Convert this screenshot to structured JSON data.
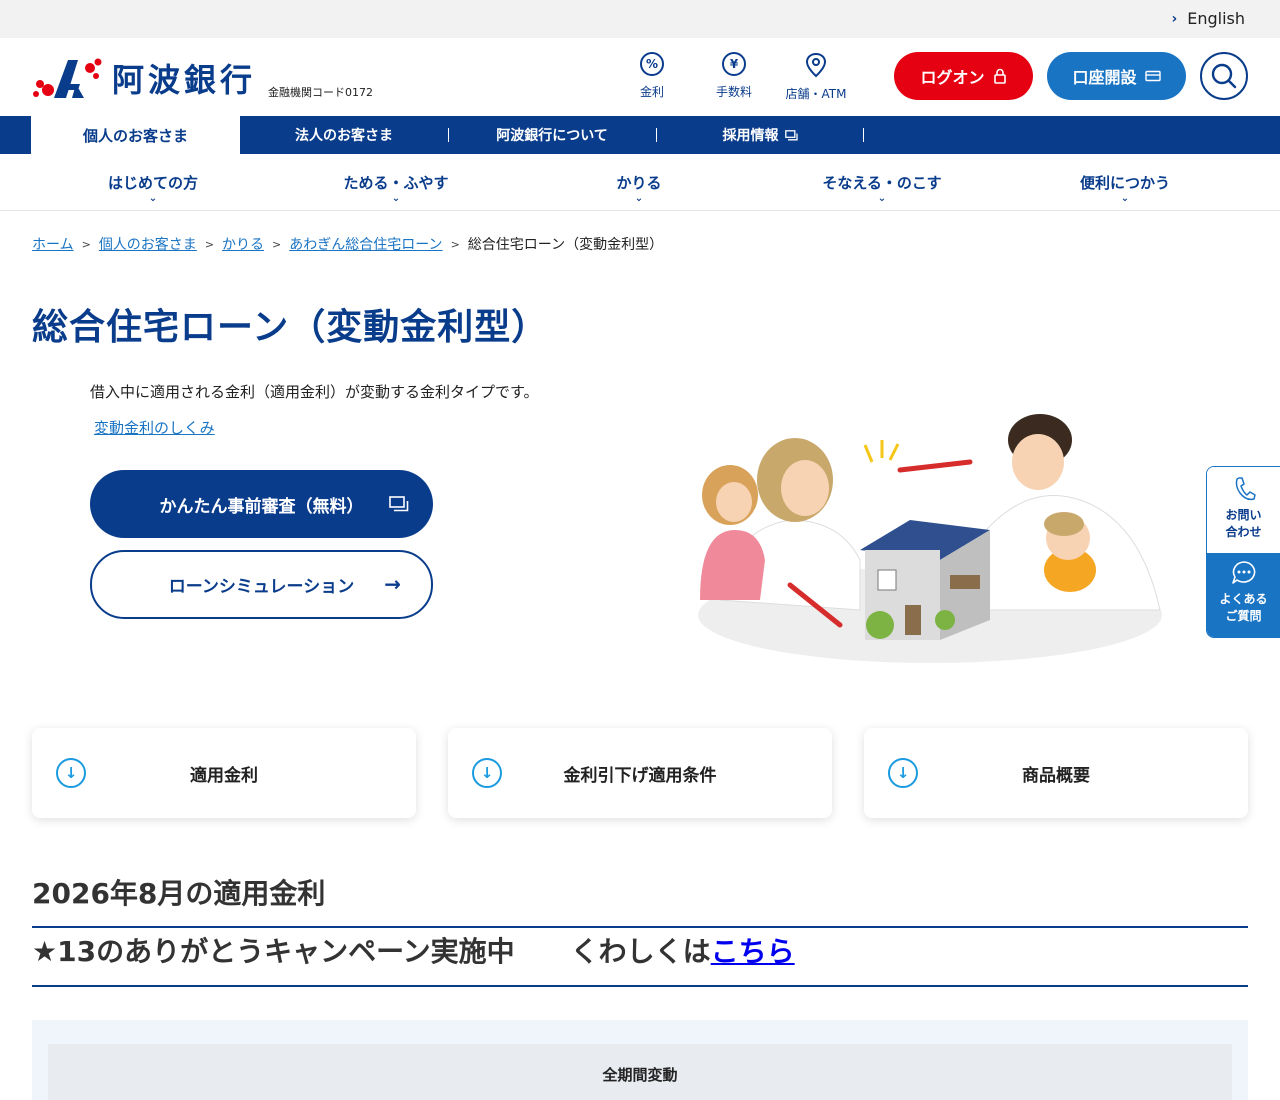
{
  "topbar": {
    "english": "English"
  },
  "header": {
    "bank_name": "阿波銀行",
    "bank_code": "金融機関コード0172",
    "utils": [
      {
        "label": "金利",
        "icon": "percent-icon"
      },
      {
        "label": "手数料",
        "icon": "yen-icon"
      },
      {
        "label": "店舗・ATM",
        "icon": "map-pin-icon"
      }
    ],
    "logon": "ログオン",
    "open_account": "口座開設"
  },
  "gnav": {
    "tabs": [
      "個人のお客さま",
      "法人のお客さま",
      "阿波銀行について",
      "採用情報"
    ]
  },
  "snav": {
    "items": [
      "はじめての方",
      "ためる・ふやす",
      "かりる",
      "そなえる・のこす",
      "便利につかう"
    ]
  },
  "breadcrumb": {
    "links": [
      "ホーム",
      "個人のお客さま",
      "かりる",
      "あわぎん総合住宅ローン"
    ],
    "current": "総合住宅ローン（変動金利型）"
  },
  "page": {
    "title": "総合住宅ローン（変動金利型）",
    "lead": "借入中に適用される金利（適用金利）が変動する金利タイプです。",
    "lead_link": "変動金利のしくみ",
    "btn_precheck": "かんたん事前審査（無料）",
    "btn_simulation": "ローンシミュレーション"
  },
  "side": {
    "contact": "お問い\n合わせ",
    "faq": "よくある\nご質問"
  },
  "cards": [
    "適用金利",
    "金利引下げ適用条件",
    "商品概要"
  ],
  "rates": {
    "heading": "2026年8月の適用金利",
    "campaign": "★13のありがとうキャンペーン実施中　　くわしくは",
    "campaign_link": "こちら",
    "table_header": "全期間変動"
  },
  "colors": {
    "brand_navy": "#0a3c8c",
    "logon_red": "#e50012",
    "account_blue": "#1a74c4"
  }
}
